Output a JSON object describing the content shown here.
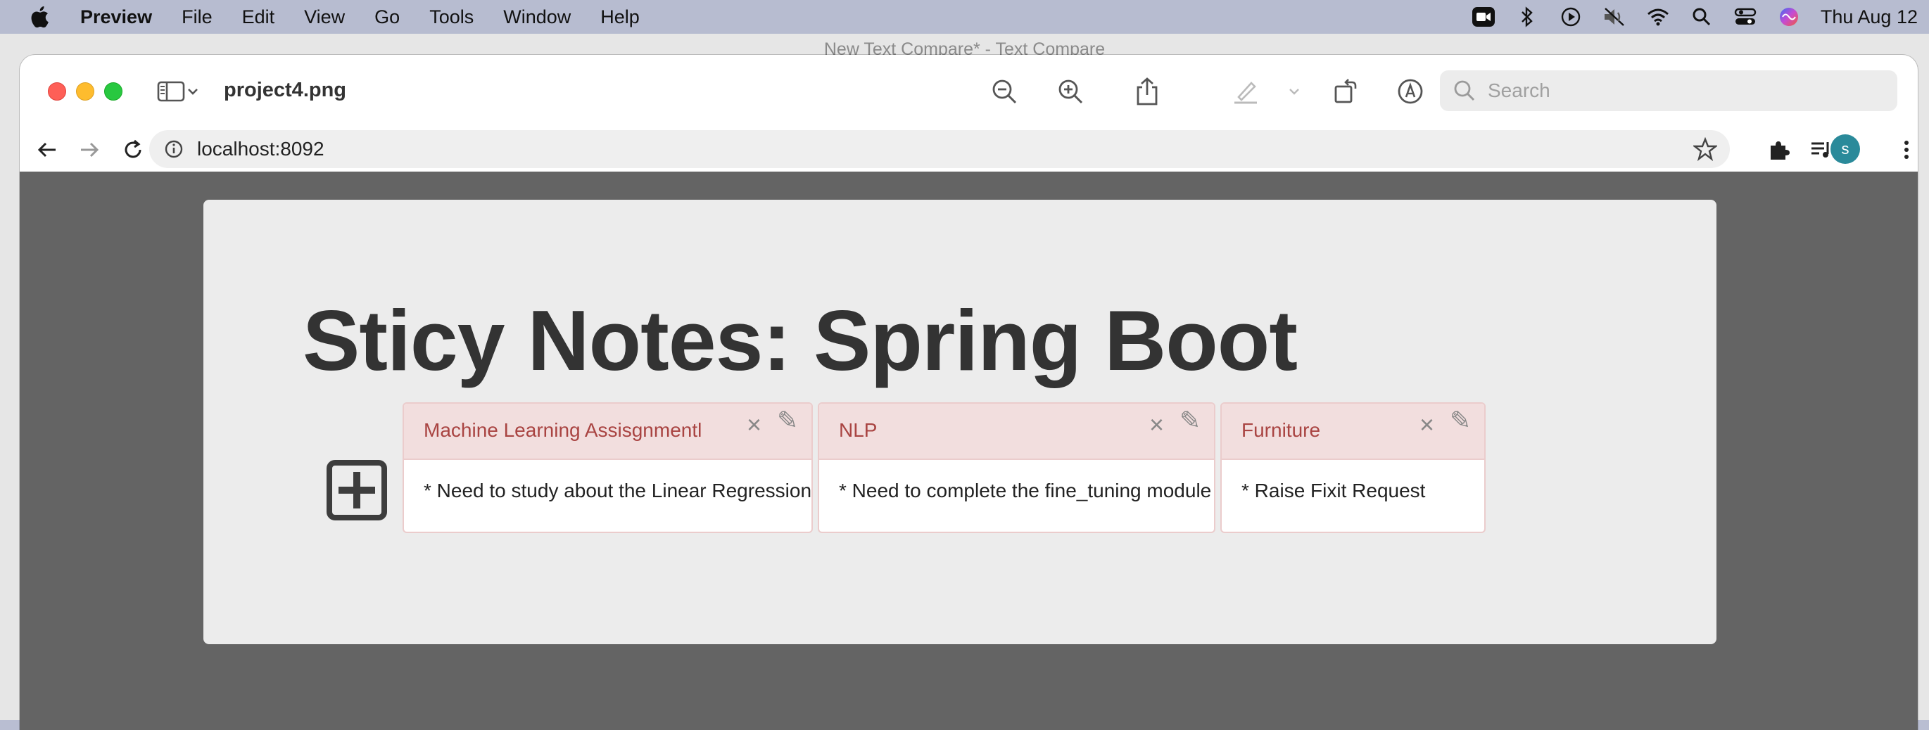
{
  "menubar": {
    "app_name": "Preview",
    "items": [
      "File",
      "Edit",
      "View",
      "Go",
      "Tools",
      "Window",
      "Help"
    ],
    "clock": "Thu Aug 12"
  },
  "background_window": {
    "title": "New Text Compare* - Text Compare"
  },
  "preview": {
    "document_title": "project4.png",
    "search_placeholder": "Search"
  },
  "browser": {
    "url": "localhost:8092",
    "avatar_initial": "s"
  },
  "page": {
    "title": "Sticy Notes: Spring Boot",
    "notes": [
      {
        "title": "Machine Learning Assisgnmentl",
        "body": "* Need to study about the Linear Regression"
      },
      {
        "title": "NLP",
        "body": "* Need to complete the fine_tuning module"
      },
      {
        "title": "Furniture",
        "body": "* Raise Fixit Request"
      }
    ]
  },
  "colors": {
    "note_header_bg": "#f2dede",
    "note_border": "#ebcccc",
    "note_title": "#a94442",
    "page_bg": "#646464",
    "card_bg": "#ececec"
  },
  "icons": {
    "close": "close-icon",
    "edit": "pencil-icon",
    "add": "plus-square-icon"
  }
}
